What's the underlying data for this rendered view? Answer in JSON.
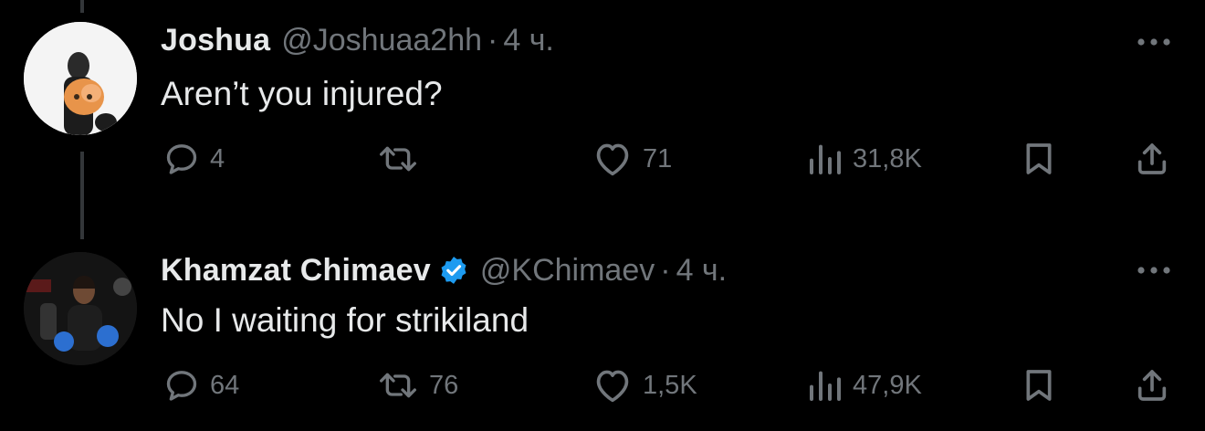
{
  "colors": {
    "background": "#000000",
    "text": "#e7e9ea",
    "secondary": "#71767b",
    "verified": "#1d9bf0"
  },
  "tweets": [
    {
      "name": "Joshua",
      "handle": "@Joshuaa2hh",
      "separator": "·",
      "time": "4 ч.",
      "verified": false,
      "text": "Aren’t you injured?",
      "replies": "4",
      "retweets": "",
      "likes": "71",
      "views": "31,8K"
    },
    {
      "name": "Khamzat Chimaev",
      "handle": "@KChimaev",
      "separator": "·",
      "time": "4 ч.",
      "verified": true,
      "text": "No I waiting for strikiland",
      "replies": "64",
      "retweets": "76",
      "likes": "1,5K",
      "views": "47,9K"
    }
  ],
  "icons": [
    "reply-icon",
    "retweet-icon",
    "like-icon",
    "views-icon",
    "bookmark-icon",
    "share-icon",
    "more-icon",
    "verified-badge-icon"
  ]
}
